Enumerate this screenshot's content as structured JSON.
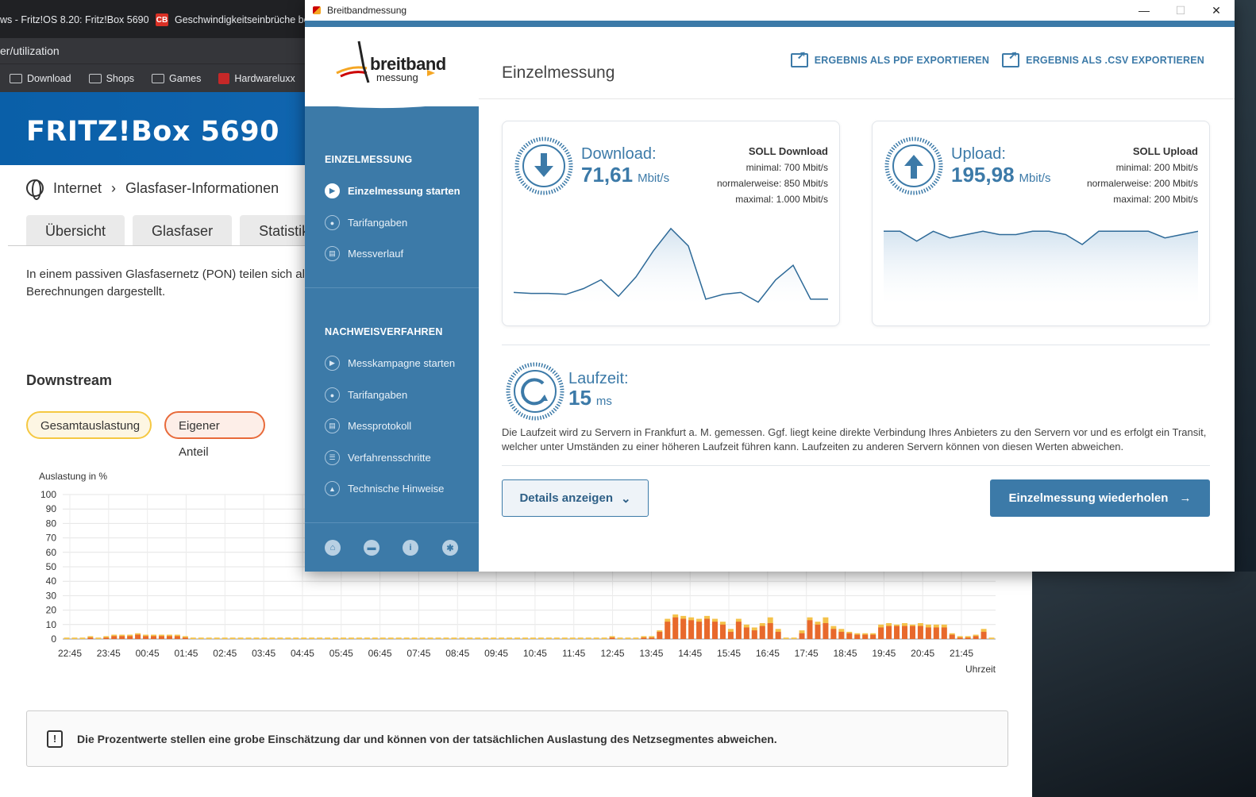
{
  "browser": {
    "tabs": [
      {
        "label": "ws - Fritz!OS 8.20: Fritz!Box 5690",
        "close": "✕"
      },
      {
        "label": "Geschwindigkeitseinbrüche bei",
        "icon_text": "CB"
      }
    ],
    "url": "er/utilization",
    "bookmarks": [
      "Download",
      "Shops",
      "Games",
      "Hardwareluxx"
    ]
  },
  "fritz": {
    "title": "FRITZ!Box 5690",
    "breadcrumb": [
      "Internet",
      "Glasfaser-Informationen"
    ],
    "tabs": [
      "Übersicht",
      "Glasfaser",
      "Statistik"
    ],
    "info_text": "In einem passiven Glasfasernetz (PON) teilen sich al Berechnungen dargestellt.",
    "section_title": "Downstream",
    "pills": [
      "Gesamtauslastung",
      "Eigener Anteil"
    ],
    "notice": "Die Prozentwerte stellen eine grobe Einschätzung dar und können von der tatsächlichen Auslastung des Netzsegmentes abweichen.",
    "notice_icon": "!"
  },
  "chart_data": {
    "type": "bar",
    "ylabel": "Auslastung in %",
    "xlabel": "Uhrzeit",
    "ylim": [
      0,
      100
    ],
    "yticks": [
      0,
      10,
      20,
      30,
      40,
      50,
      60,
      70,
      80,
      90,
      100
    ],
    "xticks": [
      "22:45",
      "23:45",
      "00:45",
      "01:45",
      "02:45",
      "03:45",
      "04:45",
      "05:45",
      "06:45",
      "07:45",
      "08:45",
      "09:45",
      "10:45",
      "11:45",
      "12:45",
      "13:45",
      "14:45",
      "15:45",
      "16:45",
      "17:45",
      "18:45",
      "19:45",
      "20:45",
      "21:45"
    ],
    "series": [
      {
        "name": "Eigener Anteil",
        "color": "#e8692c",
        "values": [
          0,
          0,
          0,
          1,
          0,
          1,
          2,
          2,
          2,
          3,
          2,
          2,
          2,
          2,
          2,
          1,
          0,
          0,
          0,
          0,
          0,
          0,
          0,
          0,
          0,
          0,
          0,
          0,
          0,
          0,
          0,
          0,
          0,
          0,
          0,
          0,
          0,
          0,
          0,
          0,
          0,
          0,
          0,
          0,
          0,
          0,
          0,
          0,
          0,
          0,
          0,
          0,
          0,
          0,
          0,
          0,
          0,
          0,
          0,
          0,
          0,
          0,
          0,
          0,
          0,
          0,
          0,
          0,
          0,
          1,
          0,
          0,
          0,
          1,
          1,
          5,
          12,
          15,
          14,
          13,
          12,
          14,
          12,
          10,
          5,
          12,
          8,
          6,
          9,
          11,
          5,
          0,
          0,
          4,
          13,
          10,
          11,
          7,
          5,
          4,
          3,
          3,
          3,
          8,
          9,
          9,
          9,
          9,
          9,
          8,
          8,
          8,
          3,
          1,
          1,
          2,
          5,
          0
        ]
      },
      {
        "name": "Gesamtauslastung",
        "color": "#f4c24a",
        "values": [
          1,
          1,
          1,
          2,
          1,
          2,
          3,
          3,
          3,
          4,
          3,
          3,
          3,
          3,
          3,
          2,
          1,
          1,
          1,
          1,
          1,
          1,
          1,
          1,
          1,
          1,
          1,
          1,
          1,
          1,
          1,
          1,
          1,
          1,
          1,
          1,
          1,
          1,
          1,
          1,
          1,
          1,
          1,
          1,
          1,
          1,
          1,
          1,
          1,
          1,
          1,
          1,
          1,
          1,
          1,
          1,
          1,
          1,
          1,
          1,
          1,
          1,
          1,
          1,
          1,
          1,
          1,
          1,
          1,
          2,
          1,
          1,
          1,
          2,
          2,
          6,
          14,
          17,
          16,
          15,
          14,
          16,
          14,
          12,
          7,
          14,
          10,
          8,
          11,
          15,
          7,
          1,
          1,
          6,
          15,
          12,
          15,
          9,
          7,
          5,
          4,
          4,
          4,
          10,
          11,
          10,
          11,
          10,
          11,
          10,
          10,
          10,
          4,
          2,
          2,
          3,
          7,
          1
        ]
      }
    ]
  },
  "bb": {
    "window_title": "Breitbandmessung",
    "win_controls": {
      "min": "—",
      "max": "☐",
      "close": "✕"
    },
    "logo_main": "breitband",
    "logo_sub": "messung",
    "nav": {
      "section1": "EINZELMESSUNG",
      "items1": [
        "Einzelmessung starten",
        "Tarifangaben",
        "Messverlauf"
      ],
      "section2": "NACHWEISVERFAHREN",
      "items2": [
        "Messkampagne starten",
        "Tarifangaben",
        "Messprotokoll",
        "Verfahrensschritte",
        "Technische Hinweise"
      ]
    },
    "page_title": "Einzelmessung",
    "export_pdf": "ERGEBNIS ALS PDF EXPORTIEREN",
    "export_csv": "ERGEBNIS ALS .CSV EXPORTIEREN",
    "download": {
      "label": "Download:",
      "value": "71,61",
      "unit": "Mbit/s",
      "soll_title": "SOLL Download",
      "soll_min": "minimal: 700 Mbit/s",
      "soll_norm": "normalerweise: 850 Mbit/s",
      "soll_max": "maximal: 1.000 Mbit/s",
      "samples": [
        62,
        61,
        61,
        60,
        66,
        75,
        58,
        78,
        105,
        128,
        110,
        55,
        60,
        62,
        52,
        75,
        90,
        55,
        55
      ]
    },
    "upload": {
      "label": "Upload:",
      "value": "195,98",
      "unit": "Mbit/s",
      "soll_title": "SOLL Upload",
      "soll_min": "minimal: 200 Mbit/s",
      "soll_norm": "normalerweise: 200 Mbit/s",
      "soll_max": "maximal: 200 Mbit/s",
      "samples": [
        197,
        197,
        194,
        197,
        195,
        196,
        197,
        196,
        196,
        197,
        197,
        196,
        193,
        197,
        197,
        197,
        197,
        195,
        196,
        197
      ]
    },
    "latency": {
      "label": "Laufzeit:",
      "value": "15",
      "unit": "ms",
      "text": "Die Laufzeit wird zu Servern in Frankfurt a. M. gemessen. Ggf. liegt keine direkte Verbindung Ihres Anbieters zu den Servern vor und es erfolgt ein Transit, welcher unter Umständen zu einer höheren Laufzeit führen kann. Laufzeiten zu anderen Servern können von diesen Werten abweichen."
    },
    "btn_details": "Details anzeigen",
    "btn_repeat": "Einzelmessung wiederholen"
  }
}
